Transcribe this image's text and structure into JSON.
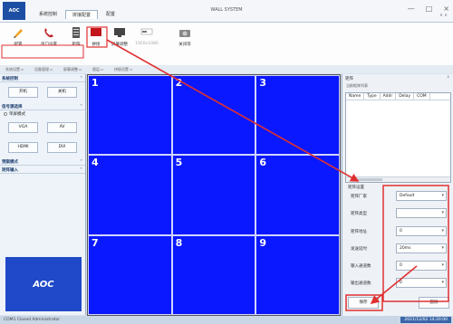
{
  "window": {
    "logo_text": "AOC",
    "title": "WALL SYSTEM",
    "controls": [
      "—",
      "□",
      "×"
    ],
    "right_arrows": "∨ ∧"
  },
  "menu_tabs": [
    "系统控制",
    "拼接配置",
    "配置"
  ],
  "toolbar": {
    "tools": [
      {
        "label": "配置",
        "icon": "pencil-icon",
        "disabled": false
      },
      {
        "label": "串口设置",
        "icon": "phone-icon",
        "disabled": false
      },
      {
        "label": "矩阵",
        "icon": "matrix-icon",
        "disabled": false
      },
      {
        "label": "拼接",
        "icon": "splice-icon",
        "disabled": false
      },
      {
        "label": "屏幕调整",
        "icon": "monitor-icon",
        "disabled": false
      },
      {
        "label": "1920x1080",
        "icon": "resolution-icon",
        "disabled": true
      },
      {
        "label": "关闭等",
        "icon": "camera-icon",
        "disabled": false
      }
    ],
    "groups": [
      "系统设置 ▫",
      "设备管理 ▫",
      "屏幕调整 ▫",
      "图层 ▫",
      "拼接设置 ▫"
    ]
  },
  "left_panel": {
    "section1_title": "系统控制",
    "power_on": "开机",
    "power_off": "关机",
    "section2_title": "信号源选择",
    "mode_label": "单屏模式",
    "sources": [
      "VGA",
      "AV",
      "HDMI",
      "DVI"
    ],
    "section3_title": "预案模式",
    "section4_title": "矩阵输入",
    "brand": "AOC"
  },
  "wall": {
    "cells": [
      "1",
      "2",
      "3",
      "4",
      "5",
      "6",
      "7",
      "8",
      "9"
    ],
    "color": "#0a18ff"
  },
  "right_panel": {
    "title": "矩阵",
    "subtitle": "当前矩阵列表",
    "columns": [
      "Name",
      "Type",
      "Addr",
      "Delay",
      "COM"
    ],
    "settings_title": "矩阵设置",
    "fields": [
      {
        "label": "矩阵厂家",
        "value": "Default"
      },
      {
        "label": "矩阵类型",
        "value": ""
      },
      {
        "label": "矩阵地址",
        "value": "0"
      },
      {
        "label": "发送延时",
        "value": "20ms"
      },
      {
        "label": "输入通道数",
        "value": "0"
      },
      {
        "label": "输出通道数",
        "value": "0"
      }
    ],
    "save_button": "保存",
    "delete_button": "删除"
  },
  "status_bar": {
    "text": "COM1 Closed   Administrator",
    "time": "2021/12/02 14:20:00"
  },
  "annotation_color": "#e03030"
}
